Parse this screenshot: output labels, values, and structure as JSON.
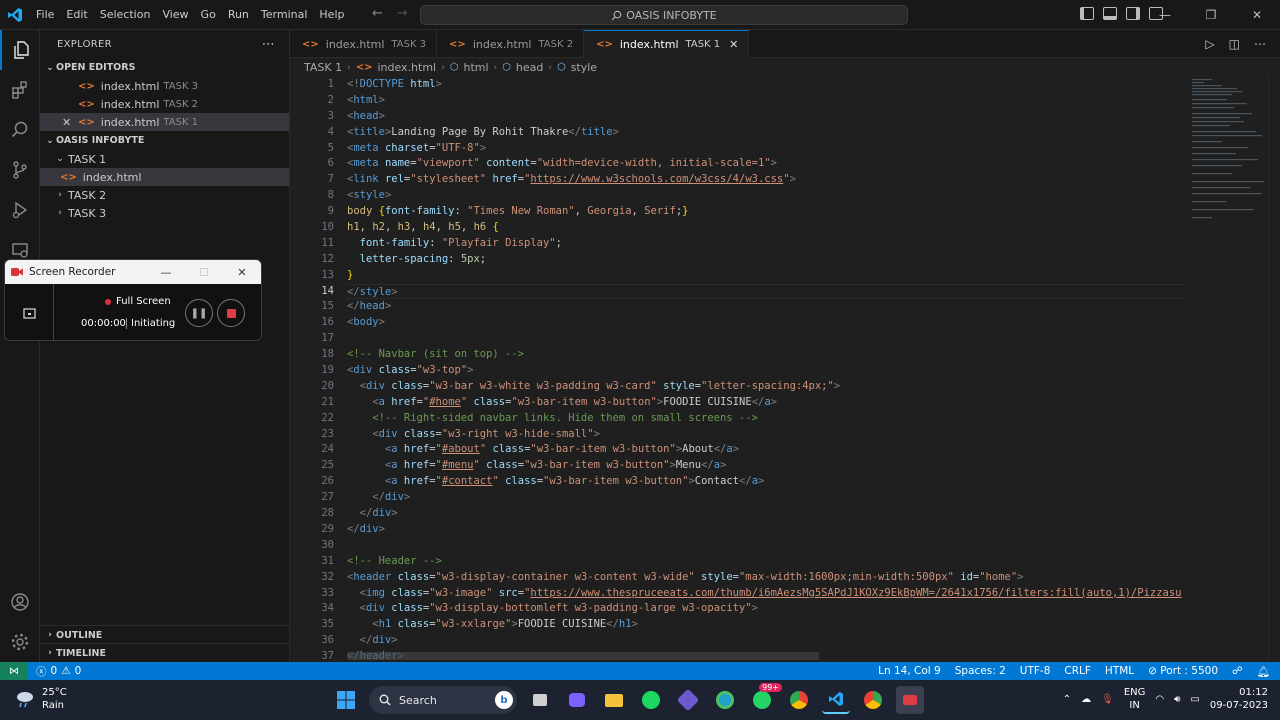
{
  "titlebar": {
    "menu": [
      "File",
      "Edit",
      "Selection",
      "View",
      "Go",
      "Run",
      "Terminal",
      "Help"
    ],
    "search_text": "OASIS INFOBYTE"
  },
  "sidebar": {
    "title": "EXPLORER",
    "open_editors_label": "OPEN EDITORS",
    "open_editors": [
      {
        "name": "index.html",
        "folder": "TASK 3"
      },
      {
        "name": "index.html",
        "folder": "TASK 2"
      },
      {
        "name": "index.html",
        "folder": "TASK 1"
      }
    ],
    "workspace_label": "OASIS INFOBYTE",
    "tree": {
      "task1": "TASK 1",
      "task1_file": "index.html",
      "task2": "TASK 2",
      "task3": "TASK 3"
    },
    "outline_label": "OUTLINE",
    "timeline_label": "TIMELINE"
  },
  "tabs": [
    {
      "name": "index.html",
      "folder": "TASK 3"
    },
    {
      "name": "index.html",
      "folder": "TASK 2"
    },
    {
      "name": "index.html",
      "folder": "TASK 1"
    }
  ],
  "breadcrumb": {
    "folder": "TASK 1",
    "file": "index.html",
    "node1": "html",
    "node2": "head",
    "node3": "style"
  },
  "editor": {
    "current_line": 14,
    "lines": [
      [
        [
          "br",
          "<!"
        ],
        [
          "tag",
          "DOCTYPE"
        ],
        [
          "txt",
          " "
        ],
        [
          "attr",
          "html"
        ],
        [
          "br",
          ">"
        ]
      ],
      [
        [
          "br",
          "<"
        ],
        [
          "tag",
          "html"
        ],
        [
          "br",
          ">"
        ]
      ],
      [
        [
          "br",
          "<"
        ],
        [
          "tag",
          "head"
        ],
        [
          "br",
          ">"
        ]
      ],
      [
        [
          "br",
          "<"
        ],
        [
          "tag",
          "title"
        ],
        [
          "br",
          ">"
        ],
        [
          "txt",
          "Landing Page By Rohit Thakre"
        ],
        [
          "br",
          "</"
        ],
        [
          "tag",
          "title"
        ],
        [
          "br",
          ">"
        ]
      ],
      [
        [
          "br",
          "<"
        ],
        [
          "tag",
          "meta"
        ],
        [
          "txt",
          " "
        ],
        [
          "attr",
          "charset"
        ],
        [
          "txt",
          "="
        ],
        [
          "str",
          "\"UTF-8\""
        ],
        [
          "br",
          ">"
        ]
      ],
      [
        [
          "br",
          "<"
        ],
        [
          "tag",
          "meta"
        ],
        [
          "txt",
          " "
        ],
        [
          "attr",
          "name"
        ],
        [
          "txt",
          "="
        ],
        [
          "str",
          "\"viewport\""
        ],
        [
          "txt",
          " "
        ],
        [
          "attr",
          "content"
        ],
        [
          "txt",
          "="
        ],
        [
          "str",
          "\"width=device-width, initial-scale=1\""
        ],
        [
          "br",
          ">"
        ]
      ],
      [
        [
          "br",
          "<"
        ],
        [
          "tag",
          "link"
        ],
        [
          "txt",
          " "
        ],
        [
          "attr",
          "rel"
        ],
        [
          "txt",
          "="
        ],
        [
          "str",
          "\"stylesheet\""
        ],
        [
          "txt",
          " "
        ],
        [
          "attr",
          "href"
        ],
        [
          "txt",
          "="
        ],
        [
          "str",
          "\""
        ],
        [
          "url",
          "https://www.w3schools.com/w3css/4/w3.css"
        ],
        [
          "str",
          "\""
        ],
        [
          "br",
          ">"
        ]
      ],
      [
        [
          "br",
          "<"
        ],
        [
          "tag",
          "style"
        ],
        [
          "br",
          ">"
        ]
      ],
      [
        [
          "sel",
          "body"
        ],
        [
          "txt",
          " "
        ],
        [
          "punc",
          "{"
        ],
        [
          "prop",
          "font-family"
        ],
        [
          "txt",
          ": "
        ],
        [
          "str",
          "\"Times New Roman\""
        ],
        [
          "txt",
          ", "
        ],
        [
          "str",
          "Georgia"
        ],
        [
          "txt",
          ", "
        ],
        [
          "str",
          "Serif"
        ],
        [
          "txt",
          ";"
        ],
        [
          "punc",
          "}"
        ]
      ],
      [
        [
          "sel",
          "h1"
        ],
        [
          "txt",
          ", "
        ],
        [
          "sel",
          "h2"
        ],
        [
          "txt",
          ", "
        ],
        [
          "sel",
          "h3"
        ],
        [
          "txt",
          ", "
        ],
        [
          "sel",
          "h4"
        ],
        [
          "txt",
          ", "
        ],
        [
          "sel",
          "h5"
        ],
        [
          "txt",
          ", "
        ],
        [
          "sel",
          "h6"
        ],
        [
          "txt",
          " "
        ],
        [
          "punc",
          "{"
        ]
      ],
      [
        [
          "txt",
          "  "
        ],
        [
          "prop",
          "font-family"
        ],
        [
          "txt",
          ": "
        ],
        [
          "str",
          "\"Playfair Display\""
        ],
        [
          "txt",
          ";"
        ]
      ],
      [
        [
          "txt",
          "  "
        ],
        [
          "prop",
          "letter-spacing"
        ],
        [
          "txt",
          ": "
        ],
        [
          "num",
          "5px"
        ],
        [
          "txt",
          ";"
        ]
      ],
      [
        [
          "punc",
          "}"
        ]
      ],
      [
        [
          "br",
          "</"
        ],
        [
          "tag",
          "style"
        ],
        [
          "br",
          ">"
        ]
      ],
      [
        [
          "br",
          "</"
        ],
        [
          "tag",
          "head"
        ],
        [
          "br",
          ">"
        ]
      ],
      [
        [
          "br",
          "<"
        ],
        [
          "tag",
          "body"
        ],
        [
          "br",
          ">"
        ]
      ],
      [],
      [
        [
          "cmt",
          "<!-- Navbar (sit on top) -->"
        ]
      ],
      [
        [
          "br",
          "<"
        ],
        [
          "tag",
          "div"
        ],
        [
          "txt",
          " "
        ],
        [
          "attr",
          "class"
        ],
        [
          "txt",
          "="
        ],
        [
          "str",
          "\"w3-top\""
        ],
        [
          "br",
          ">"
        ]
      ],
      [
        [
          "txt",
          "  "
        ],
        [
          "br",
          "<"
        ],
        [
          "tag",
          "div"
        ],
        [
          "txt",
          " "
        ],
        [
          "attr",
          "class"
        ],
        [
          "txt",
          "="
        ],
        [
          "str",
          "\"w3-bar w3-white w3-padding w3-card\""
        ],
        [
          "txt",
          " "
        ],
        [
          "attr",
          "style"
        ],
        [
          "txt",
          "="
        ],
        [
          "str",
          "\"letter-spacing:4px;\""
        ],
        [
          "br",
          ">"
        ]
      ],
      [
        [
          "txt",
          "    "
        ],
        [
          "br",
          "<"
        ],
        [
          "tag",
          "a"
        ],
        [
          "txt",
          " "
        ],
        [
          "attr",
          "href"
        ],
        [
          "txt",
          "="
        ],
        [
          "str",
          "\""
        ],
        [
          "url",
          "#home"
        ],
        [
          "str",
          "\""
        ],
        [
          "txt",
          " "
        ],
        [
          "attr",
          "class"
        ],
        [
          "txt",
          "="
        ],
        [
          "str",
          "\"w3-bar-item w3-button\""
        ],
        [
          "br",
          ">"
        ],
        [
          "txt",
          "FOODIE CUISINE"
        ],
        [
          "br",
          "</"
        ],
        [
          "tag",
          "a"
        ],
        [
          "br",
          ">"
        ]
      ],
      [
        [
          "txt",
          "    "
        ],
        [
          "cmt",
          "<!-- Right-sided navbar links. Hide them on small screens -->"
        ]
      ],
      [
        [
          "txt",
          "    "
        ],
        [
          "br",
          "<"
        ],
        [
          "tag",
          "div"
        ],
        [
          "txt",
          " "
        ],
        [
          "attr",
          "class"
        ],
        [
          "txt",
          "="
        ],
        [
          "str",
          "\"w3-right w3-hide-small\""
        ],
        [
          "br",
          ">"
        ]
      ],
      [
        [
          "txt",
          "      "
        ],
        [
          "br",
          "<"
        ],
        [
          "tag",
          "a"
        ],
        [
          "txt",
          " "
        ],
        [
          "attr",
          "href"
        ],
        [
          "txt",
          "="
        ],
        [
          "str",
          "\""
        ],
        [
          "url",
          "#about"
        ],
        [
          "str",
          "\""
        ],
        [
          "txt",
          " "
        ],
        [
          "attr",
          "class"
        ],
        [
          "txt",
          "="
        ],
        [
          "str",
          "\"w3-bar-item w3-button\""
        ],
        [
          "br",
          ">"
        ],
        [
          "txt",
          "About"
        ],
        [
          "br",
          "</"
        ],
        [
          "tag",
          "a"
        ],
        [
          "br",
          ">"
        ]
      ],
      [
        [
          "txt",
          "      "
        ],
        [
          "br",
          "<"
        ],
        [
          "tag",
          "a"
        ],
        [
          "txt",
          " "
        ],
        [
          "attr",
          "href"
        ],
        [
          "txt",
          "="
        ],
        [
          "str",
          "\""
        ],
        [
          "url",
          "#menu"
        ],
        [
          "str",
          "\""
        ],
        [
          "txt",
          " "
        ],
        [
          "attr",
          "class"
        ],
        [
          "txt",
          "="
        ],
        [
          "str",
          "\"w3-bar-item w3-button\""
        ],
        [
          "br",
          ">"
        ],
        [
          "txt",
          "Menu"
        ],
        [
          "br",
          "</"
        ],
        [
          "tag",
          "a"
        ],
        [
          "br",
          ">"
        ]
      ],
      [
        [
          "txt",
          "      "
        ],
        [
          "br",
          "<"
        ],
        [
          "tag",
          "a"
        ],
        [
          "txt",
          " "
        ],
        [
          "attr",
          "href"
        ],
        [
          "txt",
          "="
        ],
        [
          "str",
          "\""
        ],
        [
          "url",
          "#contact"
        ],
        [
          "str",
          "\""
        ],
        [
          "txt",
          " "
        ],
        [
          "attr",
          "class"
        ],
        [
          "txt",
          "="
        ],
        [
          "str",
          "\"w3-bar-item w3-button\""
        ],
        [
          "br",
          ">"
        ],
        [
          "txt",
          "Contact"
        ],
        [
          "br",
          "</"
        ],
        [
          "tag",
          "a"
        ],
        [
          "br",
          ">"
        ]
      ],
      [
        [
          "txt",
          "    "
        ],
        [
          "br",
          "</"
        ],
        [
          "tag",
          "div"
        ],
        [
          "br",
          ">"
        ]
      ],
      [
        [
          "txt",
          "  "
        ],
        [
          "br",
          "</"
        ],
        [
          "tag",
          "div"
        ],
        [
          "br",
          ">"
        ]
      ],
      [
        [
          "br",
          "</"
        ],
        [
          "tag",
          "div"
        ],
        [
          "br",
          ">"
        ]
      ],
      [],
      [
        [
          "cmt",
          "<!-- Header -->"
        ]
      ],
      [
        [
          "br",
          "<"
        ],
        [
          "tag",
          "header"
        ],
        [
          "txt",
          " "
        ],
        [
          "attr",
          "class"
        ],
        [
          "txt",
          "="
        ],
        [
          "str",
          "\"w3-display-container w3-content w3-wide\""
        ],
        [
          "txt",
          " "
        ],
        [
          "attr",
          "style"
        ],
        [
          "txt",
          "="
        ],
        [
          "str",
          "\"max-width:1600px;min-width:500px\""
        ],
        [
          "txt",
          " "
        ],
        [
          "attr",
          "id"
        ],
        [
          "txt",
          "="
        ],
        [
          "str",
          "\"home\""
        ],
        [
          "br",
          ">"
        ]
      ],
      [
        [
          "txt",
          "  "
        ],
        [
          "br",
          "<"
        ],
        [
          "tag",
          "img"
        ],
        [
          "txt",
          " "
        ],
        [
          "attr",
          "class"
        ],
        [
          "txt",
          "="
        ],
        [
          "str",
          "\"w3-image\""
        ],
        [
          "txt",
          " "
        ],
        [
          "attr",
          "src"
        ],
        [
          "txt",
          "="
        ],
        [
          "str",
          "\""
        ],
        [
          "url",
          "https://www.thespruceeats.com/thumb/i6mAezsMg5SAPdJ1KOXz9EkBpWM=/2641x1756/filters:fill(auto,1)/Pizzasu"
        ]
      ],
      [
        [
          "txt",
          "  "
        ],
        [
          "br",
          "<"
        ],
        [
          "tag",
          "div"
        ],
        [
          "txt",
          " "
        ],
        [
          "attr",
          "class"
        ],
        [
          "txt",
          "="
        ],
        [
          "str",
          "\"w3-display-bottomleft w3-padding-large w3-opacity\""
        ],
        [
          "br",
          ">"
        ]
      ],
      [
        [
          "txt",
          "    "
        ],
        [
          "br",
          "<"
        ],
        [
          "tag",
          "h1"
        ],
        [
          "txt",
          " "
        ],
        [
          "attr",
          "class"
        ],
        [
          "txt",
          "="
        ],
        [
          "str",
          "\"w3-xxlarge\""
        ],
        [
          "br",
          ">"
        ],
        [
          "txt",
          "FOODIE CUISINE"
        ],
        [
          "br",
          "</"
        ],
        [
          "tag",
          "h1"
        ],
        [
          "br",
          ">"
        ]
      ],
      [
        [
          "txt",
          "  "
        ],
        [
          "br",
          "</"
        ],
        [
          "tag",
          "div"
        ],
        [
          "br",
          ">"
        ]
      ],
      [
        [
          "br",
          "</"
        ],
        [
          "tag",
          "header"
        ],
        [
          "br",
          ">"
        ]
      ]
    ]
  },
  "recorder": {
    "title": "Screen Recorder",
    "mode": "Full Screen",
    "time": "00:00:00",
    "state": "Initiating"
  },
  "statusbar": {
    "problems_errors": "0",
    "problems_warnings": "0",
    "position": "Ln 14, Col 9",
    "spaces": "Spaces: 2",
    "encoding": "UTF-8",
    "eol": "CRLF",
    "language": "HTML",
    "port": "Port : 5500"
  },
  "taskbar": {
    "temperature": "25°C",
    "weather": "Rain",
    "search": "Search",
    "badge": "99+",
    "lang1": "ENG",
    "lang2": "IN",
    "time": "01:12",
    "date": "09-07-2023"
  },
  "colors": {
    "accent": "#0078d4",
    "statusbar": "#0078d4",
    "remote": "#16825d",
    "editor_bg": "#1f1f1f"
  }
}
